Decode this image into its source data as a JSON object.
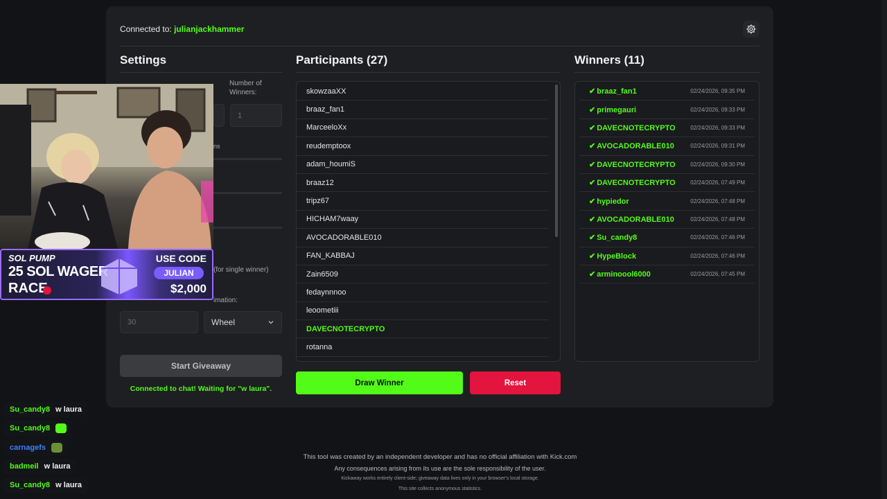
{
  "header": {
    "connected_label": "Connected to:",
    "channel": "julianjackhammer"
  },
  "settings": {
    "title": "Settings",
    "num_winners_label": "Number of\nWinners:",
    "num_winners_value": "1",
    "partial_label_1": "ns",
    "partial_label_2": "(for single winner)",
    "animation_label": "imation:",
    "delay_value": "30",
    "animation_value": "Wheel",
    "start_button": "Start Giveaway",
    "status": "Connected to chat! Waiting for \"w laura\"."
  },
  "participants": {
    "title": "Participants (27)",
    "items": [
      {
        "name": "skowzaaXX",
        "highlight": false
      },
      {
        "name": "braaz_fan1",
        "highlight": false
      },
      {
        "name": "MarceeloXx",
        "highlight": false
      },
      {
        "name": "reudemptoox",
        "highlight": false
      },
      {
        "name": "adam_houmiS",
        "highlight": false
      },
      {
        "name": "braaz12",
        "highlight": false
      },
      {
        "name": "tripz67",
        "highlight": false
      },
      {
        "name": "HICHAM7waay",
        "highlight": false
      },
      {
        "name": "AVOCADORABLE010",
        "highlight": false
      },
      {
        "name": "FAN_KABBAJ",
        "highlight": false
      },
      {
        "name": "Zain6509",
        "highlight": false
      },
      {
        "name": "fedaynnnoo",
        "highlight": false
      },
      {
        "name": "leoometiii",
        "highlight": false
      },
      {
        "name": "DAVECNOTECRYPTO",
        "highlight": true
      },
      {
        "name": "rotanna",
        "highlight": false
      }
    ],
    "draw_button": "Draw Winner",
    "reset_button": "Reset"
  },
  "winners": {
    "title": "Winners (11)",
    "items": [
      {
        "name": "braaz_fan1",
        "time": "02/24/2026, 09:35 PM"
      },
      {
        "name": "primegauri",
        "time": "02/24/2026, 09:33 PM"
      },
      {
        "name": "DAVECNOTECRYPTO",
        "time": "02/24/2026, 09:33 PM"
      },
      {
        "name": "AVOCADORABLE010",
        "time": "02/24/2026, 09:31 PM"
      },
      {
        "name": "DAVECNOTECRYPTO",
        "time": "02/24/2026, 09:30 PM"
      },
      {
        "name": "DAVECNOTECRYPTO",
        "time": "02/24/2026, 07:49 PM"
      },
      {
        "name": "hypiedor",
        "time": "02/24/2026, 07:48 PM"
      },
      {
        "name": "AVOCADORABLE010",
        "time": "02/24/2026, 07:48 PM"
      },
      {
        "name": "Su_candy8",
        "time": "02/24/2026, 07:46 PM"
      },
      {
        "name": "HypeBlock",
        "time": "02/24/2026, 07:46 PM"
      },
      {
        "name": "arminoool6000",
        "time": "02/24/2026, 07:45 PM"
      }
    ]
  },
  "ad": {
    "brand": "SOL PUMP",
    "line1": "25 SOL WAGER",
    "line2": "RACE",
    "use_code": "USE CODE",
    "code": "JULIAN",
    "amount": "$2,000"
  },
  "chat": [
    {
      "user": "Su_candy8",
      "msg": "w laura",
      "color": "#53fc18"
    },
    {
      "user": "Su_candy8",
      "msg": "",
      "color": "#53fc18"
    },
    {
      "user": "carnagefs",
      "msg": "",
      "color": "#3b82f6"
    },
    {
      "user": "badmeil",
      "msg": "w laura",
      "color": "#53fc18"
    },
    {
      "user": "Su_candy8",
      "msg": "w laura",
      "color": "#53fc18"
    }
  ],
  "footer": {
    "line1": "This tool was created by an independent developer and has no official affiliation with Kick.com",
    "line2": "Any consequences arising from its use are the sole responsibility of the user.",
    "line3": "Kickaway works entirely client-side; giveaway data lives only in your browser's local storage.",
    "line4": "This site collects anonymous statistics."
  },
  "colors": {
    "accent": "#53fc18",
    "danger": "#e3143d",
    "panel": "#1e1f22",
    "background": "#121316"
  }
}
